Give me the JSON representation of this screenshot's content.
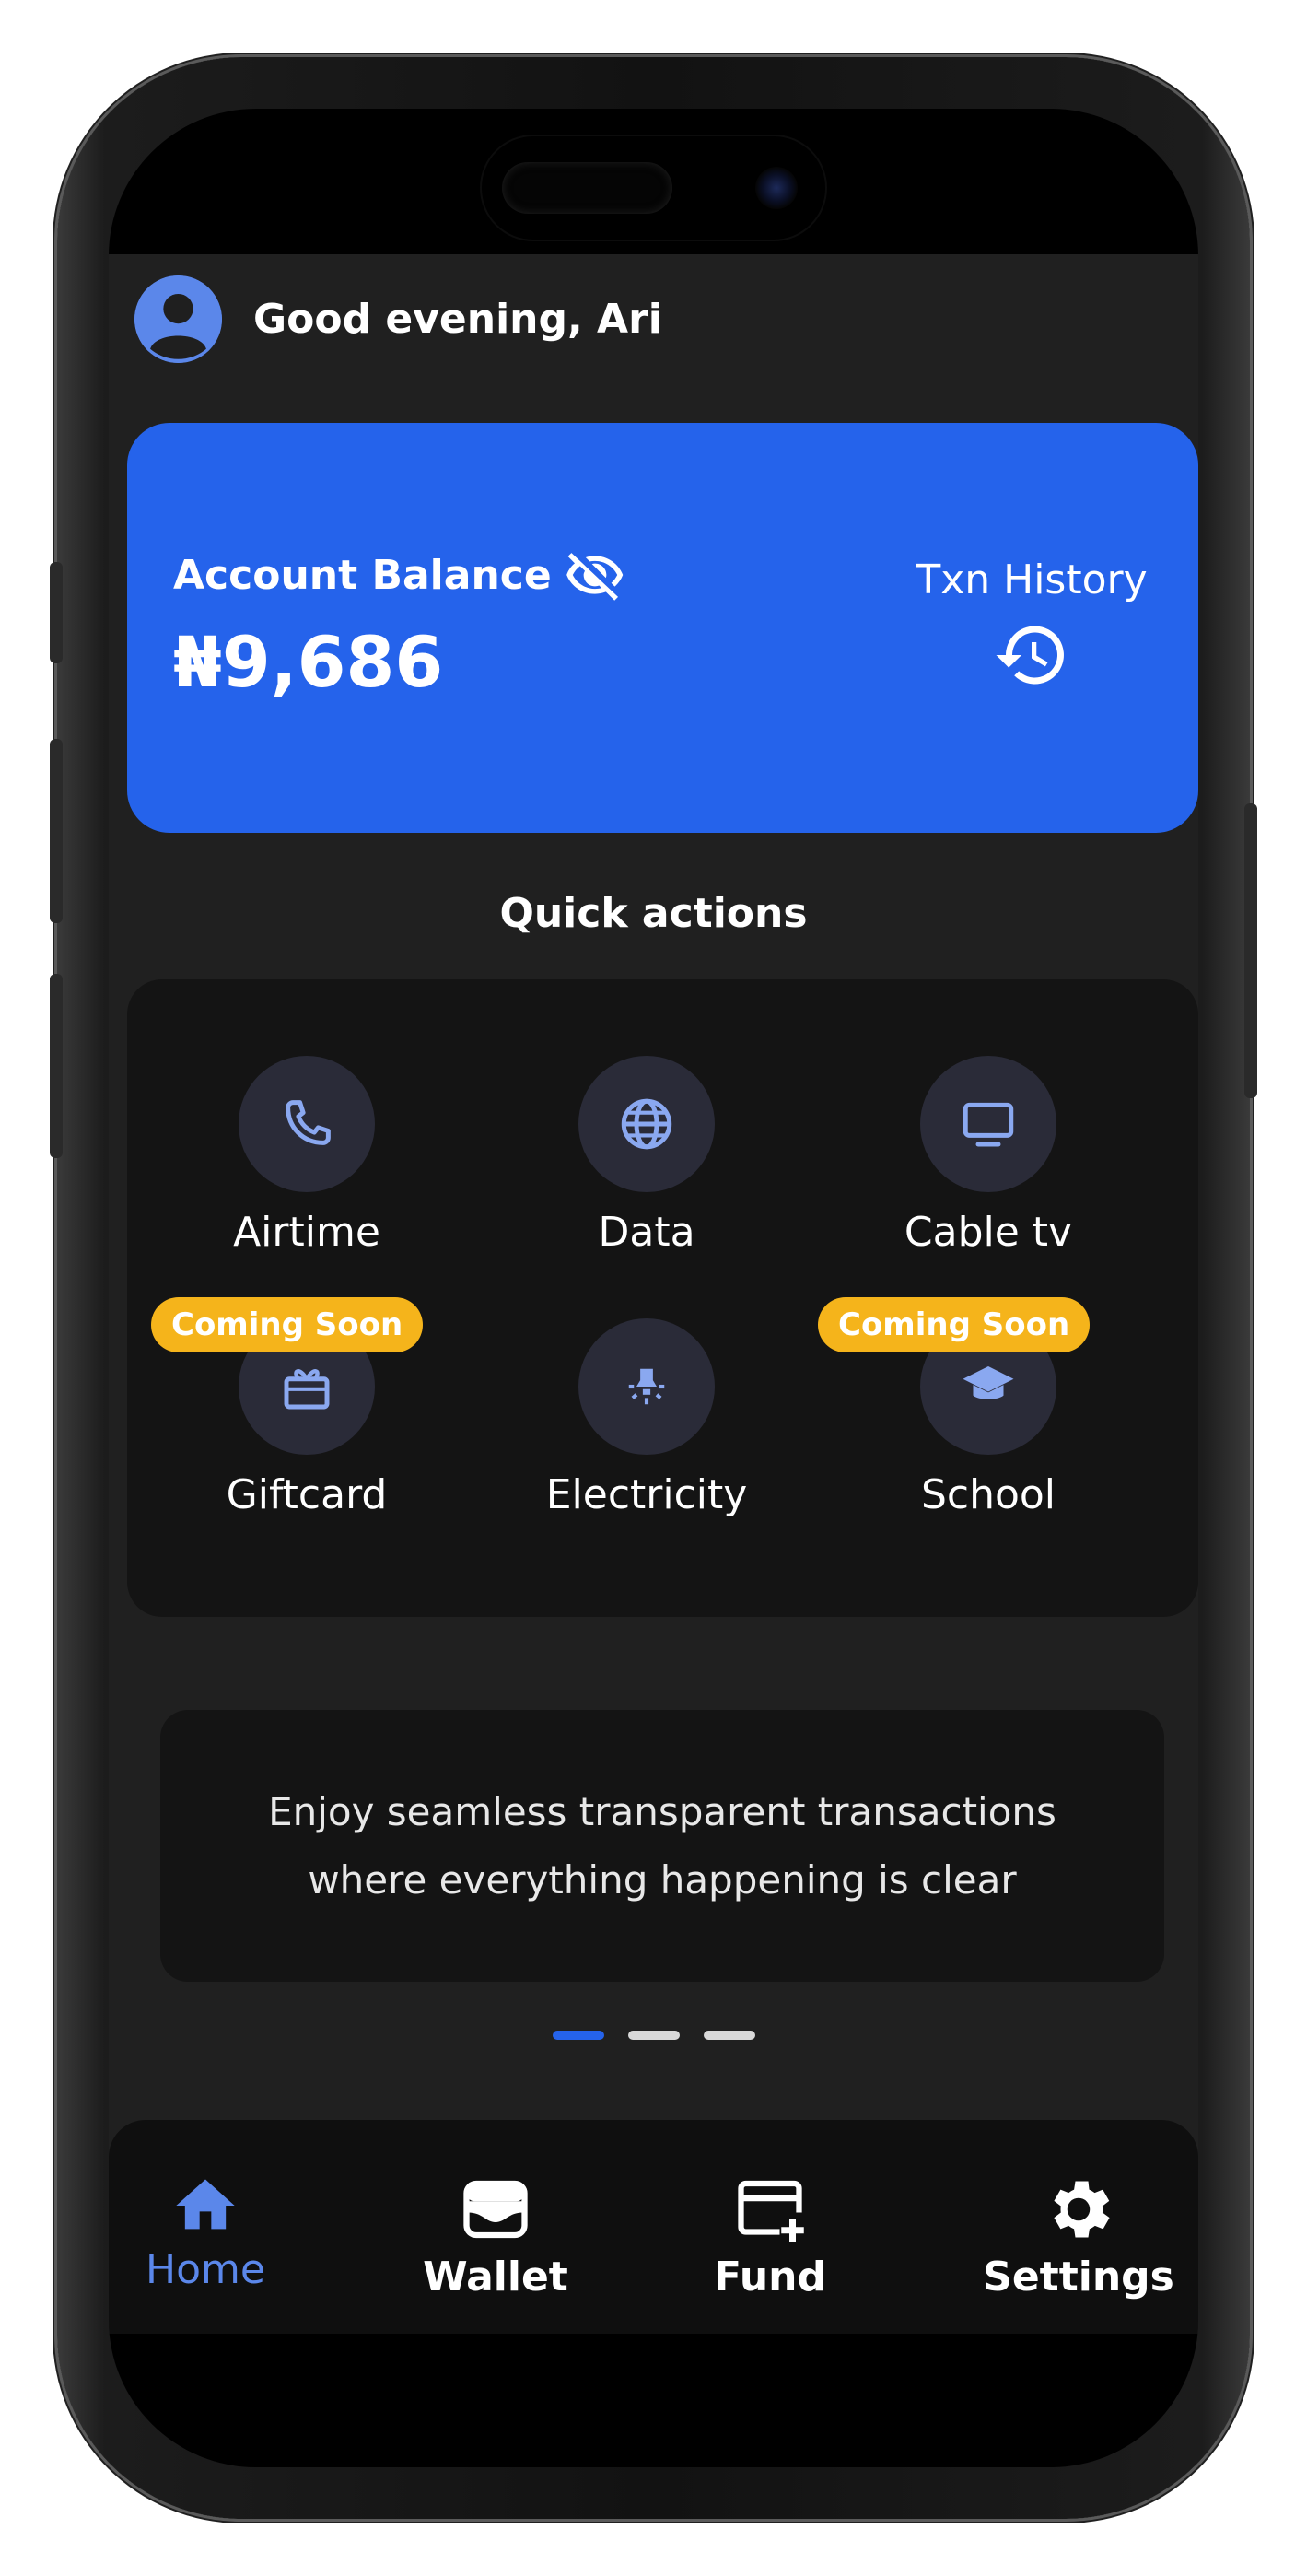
{
  "header": {
    "greeting": "Good evening, Ari"
  },
  "balance": {
    "label": "Account Balance",
    "amount": "₦9,686",
    "txn_history_label": "Txn History"
  },
  "quick_actions": {
    "title": "Quick actions",
    "items": [
      {
        "label": "Airtime",
        "icon": "phone-icon",
        "badge": ""
      },
      {
        "label": "Data",
        "icon": "globe-icon",
        "badge": ""
      },
      {
        "label": "Cable tv",
        "icon": "tv-icon",
        "badge": ""
      },
      {
        "label": "Giftcard",
        "icon": "gift-icon",
        "badge": "Coming Soon"
      },
      {
        "label": "Electricity",
        "icon": "bulb-icon",
        "badge": ""
      },
      {
        "label": "School",
        "icon": "graduation-cap-icon",
        "badge": "Coming Soon"
      }
    ]
  },
  "promo": {
    "line1": "Enjoy seamless transparent transactions",
    "line2": "where everything happening is clear"
  },
  "carousel": {
    "active_index": 0,
    "count": 3
  },
  "nav": {
    "items": [
      {
        "label": "Home",
        "icon": "home-icon",
        "active": true
      },
      {
        "label": "Wallet",
        "icon": "wallet-icon",
        "active": false
      },
      {
        "label": "Fund",
        "icon": "card-plus-icon",
        "active": false
      },
      {
        "label": "Settings",
        "icon": "gear-icon",
        "active": false
      }
    ]
  },
  "colors": {
    "accent": "#2563eb",
    "badge": "#f5b41b",
    "background": "#202020",
    "panel": "#141414",
    "nav_active": "#5b87ea"
  }
}
